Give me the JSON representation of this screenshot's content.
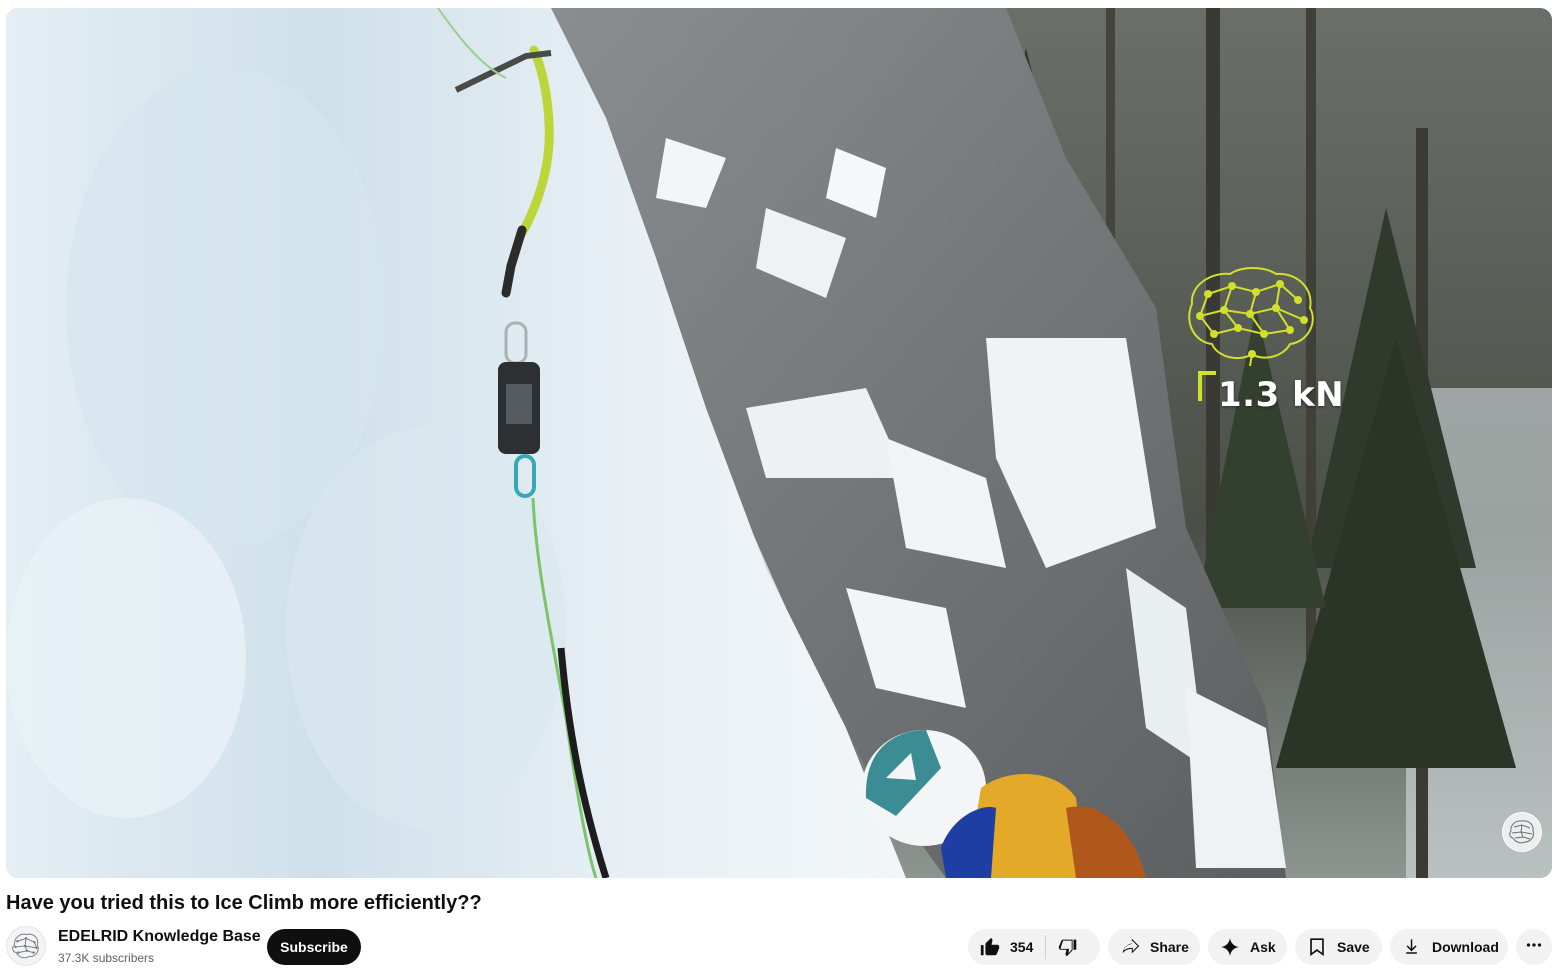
{
  "video": {
    "title": "Have you tried this to Ice Climb more efficiently??",
    "overlay_force_reading": "1.3 kN",
    "overlay_icon": "network-brain-icon",
    "watermark_icon": "channel-watermark-icon",
    "accent_color": "#d2df2b"
  },
  "channel": {
    "name": "EDELRID Knowledge Base",
    "subscribers": "37.3K subscribers",
    "avatar_icon": "network-brain-icon"
  },
  "actions": {
    "subscribe_label": "Subscribe",
    "like_count": "354",
    "like_icon": "thumbs-up-icon",
    "dislike_icon": "thumbs-down-icon",
    "share_label": "Share",
    "share_icon": "share-arrow-icon",
    "ask_label": "Ask",
    "ask_icon": "sparkle-icon",
    "save_label": "Save",
    "save_icon": "bookmark-icon",
    "download_label": "Download",
    "download_icon": "download-icon",
    "more_icon": "more-horizontal-icon"
  }
}
